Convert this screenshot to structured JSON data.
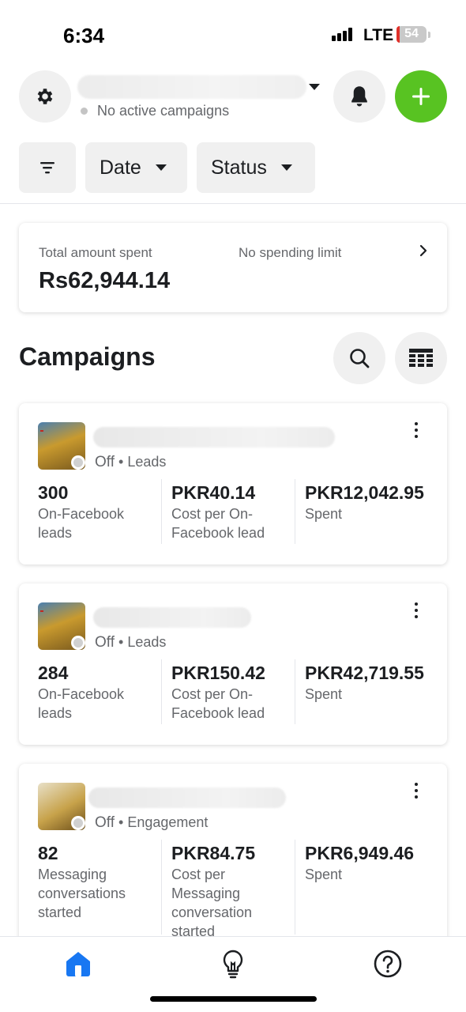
{
  "status_bar": {
    "time": "6:34",
    "network": "LTE",
    "battery": "54"
  },
  "header": {
    "account_status": "No active campaigns",
    "icons": [
      "gear-icon",
      "bell-icon",
      "plus-icon"
    ],
    "accent_color": "#58c322"
  },
  "filters": {
    "date_label": "Date",
    "status_label": "Status"
  },
  "spend": {
    "label": "Total amount spent",
    "limit": "No spending limit",
    "amount": "Rs62,944.14"
  },
  "campaigns_section": {
    "title": "Campaigns"
  },
  "campaigns": [
    {
      "state": "Off",
      "objective": "Leads",
      "metrics": [
        {
          "value": "300",
          "label": "On-Facebook leads"
        },
        {
          "value": "PKR40.14",
          "label": "Cost per On-Facebook lead"
        },
        {
          "value": "PKR12,042.95",
          "label": "Spent"
        }
      ]
    },
    {
      "state": "Off",
      "objective": "Leads",
      "metrics": [
        {
          "value": "284",
          "label": "On-Facebook leads"
        },
        {
          "value": "PKR150.42",
          "label": "Cost per On-Facebook lead"
        },
        {
          "value": "PKR42,719.55",
          "label": "Spent"
        }
      ]
    },
    {
      "state": "Off",
      "objective": "Engagement",
      "metrics": [
        {
          "value": "82",
          "label": "Messaging conversations started"
        },
        {
          "value": "PKR84.75",
          "label": "Cost per Messaging conversation started"
        },
        {
          "value": "PKR6,949.46",
          "label": "Spent"
        }
      ]
    }
  ],
  "bottom_nav": {
    "items": [
      "home-icon",
      "lightbulb-icon",
      "help-icon"
    ],
    "active_color": "#1877f2"
  }
}
